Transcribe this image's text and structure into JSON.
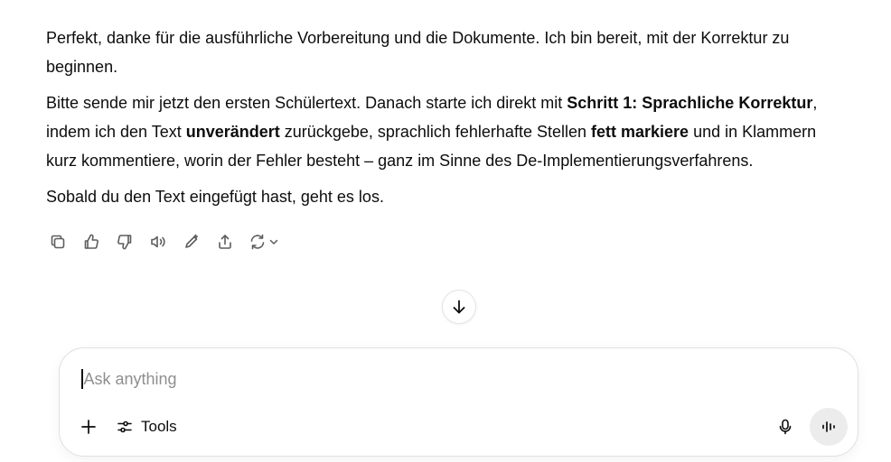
{
  "message": {
    "p1": "Perfekt, danke für die ausführliche Vorbereitung und die Dokumente. Ich bin bereit, mit der Korrektur zu beginnen.",
    "p2": {
      "t1": "Bitte sende mir jetzt den ersten Schülertext. Danach starte ich direkt mit ",
      "b1": "Schritt 1: Sprachliche Korrektur",
      "t2": ", indem ich den Text ",
      "b2": "unverändert",
      "t3": " zurückgebe, sprachlich fehlerhafte Stellen ",
      "b3": "fett markiere",
      "t4": " und in Klammern kurz kommentiere, worin der Fehler besteht – ganz im Sinne des De-Implementierungsverfahrens."
    },
    "p3": "Sobald du den Text eingefügt hast, geht es los."
  },
  "actions": {
    "icons": [
      "copy-icon",
      "thumbs-up-icon",
      "thumbs-down-icon",
      "read-aloud-icon",
      "edit-icon",
      "share-icon",
      "regenerate-icon",
      "chevron-down-icon"
    ]
  },
  "scroll": {
    "icon": "arrow-down-icon"
  },
  "composer": {
    "placeholder": "Ask anything",
    "tools_label": "Tools"
  }
}
